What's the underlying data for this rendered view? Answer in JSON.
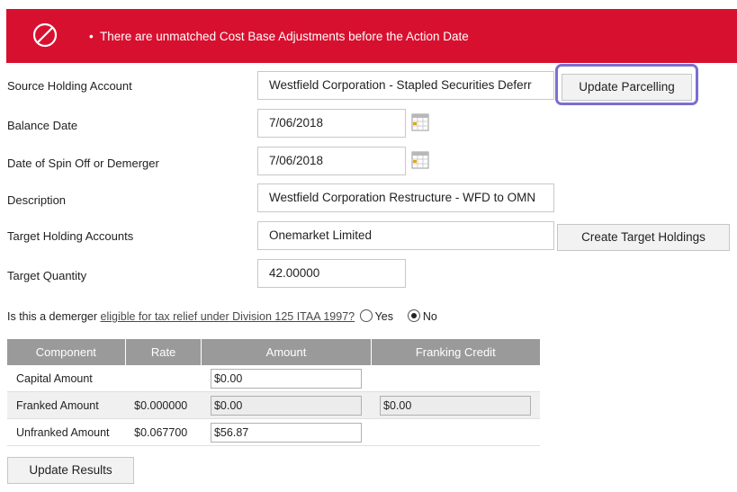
{
  "banner": {
    "bullet": "•",
    "message": "There are unmatched Cost Base Adjustments before the Action Date"
  },
  "form": {
    "source_label": "Source Holding Account",
    "source_value": "Westfield Corporation - Stapled Securities Deferr",
    "update_parcelling": "Update Parcelling",
    "balance_label": "Balance Date",
    "balance_value": "7/06/2018",
    "spin_label": "Date of Spin Off or Demerger",
    "spin_value": "7/06/2018",
    "desc_label": "Description",
    "desc_value": "Westfield Corporation Restructure - WFD to OMN",
    "target_label": "Target Holding Accounts",
    "target_value": "Onemarket Limited",
    "create_target": "Create Target Holdings",
    "qty_label": "Target Quantity",
    "qty_value": "42.00000"
  },
  "question": {
    "prefix": "Is this a demerger",
    "link": "eligible for tax relief under Division 125 ITAA 1997?",
    "yes": "Yes",
    "no": "No",
    "selected": "No"
  },
  "table": {
    "headers": [
      "Component",
      "Rate",
      "Amount",
      "Franking Credit"
    ],
    "rows": [
      {
        "component": "Capital Amount",
        "rate": "",
        "amount": "$0.00",
        "franking": ""
      },
      {
        "component": "Franked Amount",
        "rate": "$0.000000",
        "amount": "$0.00",
        "franking": "$0.00"
      },
      {
        "component": "Unfranked Amount",
        "rate": "$0.067700",
        "amount": "$56.87",
        "franking": ""
      }
    ]
  },
  "update_results": "Update Results",
  "colors": {
    "banner": "#d8102f",
    "highlight": "#7a6fd0",
    "table_header": "#9a9a9a"
  }
}
